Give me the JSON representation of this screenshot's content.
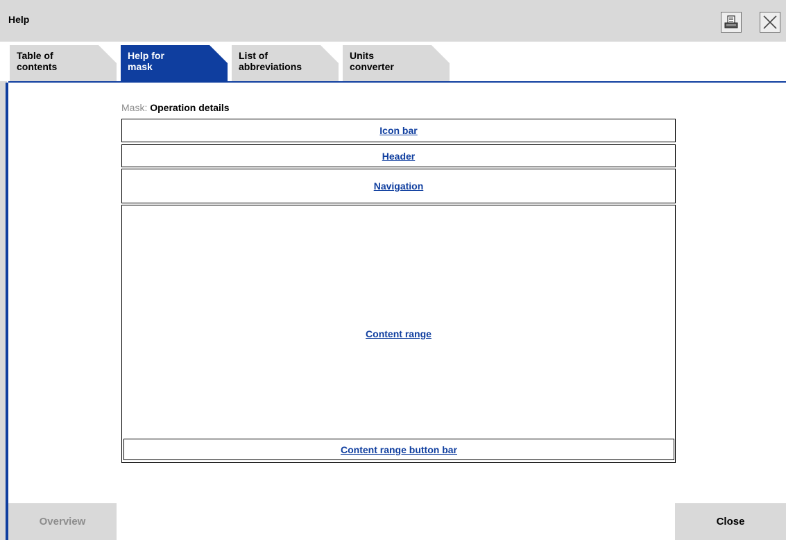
{
  "window": {
    "title": "Help",
    "print_icon": "printer-icon",
    "close_icon": "close-x-icon"
  },
  "tabs": [
    {
      "line1": "Table of",
      "line2": "contents",
      "active": false
    },
    {
      "line1": "Help for",
      "line2": "mask",
      "active": true
    },
    {
      "line1": "List of",
      "line2": "abbreviations",
      "active": false
    },
    {
      "line1": "Units",
      "line2": "converter",
      "active": false
    }
  ],
  "mask": {
    "prefix": "Mask:",
    "name": "Operation details"
  },
  "areas": {
    "icon_bar": "Icon bar",
    "header": "Header",
    "navigation": "Navigation",
    "content_range": "Content range",
    "content_button_bar": "Content range button bar"
  },
  "footer": {
    "overview_label": "Overview",
    "close_label": "Close"
  },
  "colors": {
    "accent": "#0f3e9f",
    "panel_gray": "#d9d9d9",
    "disabled_text": "#8c8c8c"
  }
}
